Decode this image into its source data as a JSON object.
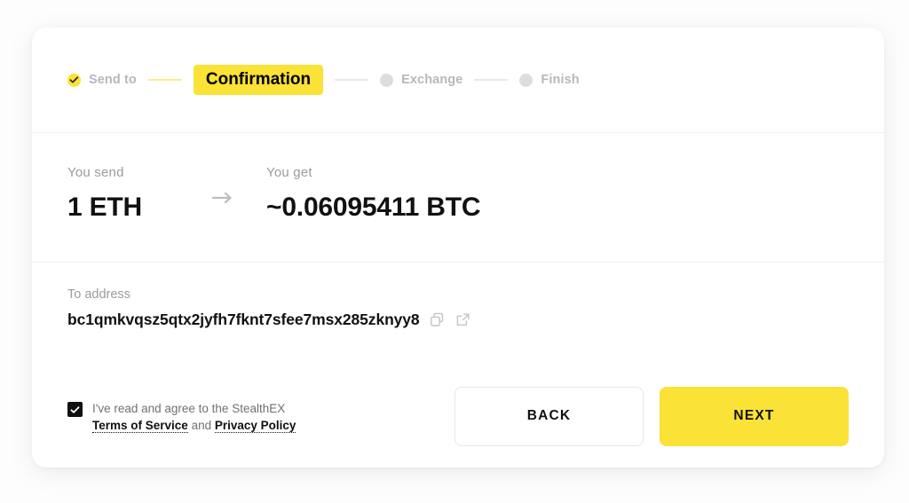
{
  "theme": {
    "accent_yellow": "#FAE237",
    "accent_yellow_light": "#FBEB8C",
    "text_dark": "#111111",
    "text_muted": "#9A9CA1",
    "step_inactive": "#DCDDE0",
    "divider": "#F0F0F2"
  },
  "stepper": {
    "steps": [
      {
        "label": "Send to",
        "state": "done",
        "icon": "check-icon"
      },
      {
        "label": "Confirmation",
        "state": "current"
      },
      {
        "label": "Exchange",
        "state": "pending",
        "icon": "dot-icon"
      },
      {
        "label": "Finish",
        "state": "pending",
        "icon": "dot-icon"
      }
    ]
  },
  "exchange": {
    "send_caption": "You send",
    "send_value": "1 ETH",
    "arrow_icon": "arrow-right-icon",
    "get_caption": "You get",
    "get_value": "~0.06095411 BTC"
  },
  "address": {
    "caption": "To address",
    "value": "bc1qmkvqsz5qtx2jyfh7fknt7sfee7msx285zknyy8",
    "copy_icon": "copy-icon",
    "external_icon": "external-link-icon"
  },
  "terms": {
    "checked": true,
    "line1": "I've read and agree to the StealthEX",
    "terms_link": "Terms of Service",
    "conjunction": " and ",
    "privacy_link": "Privacy Policy"
  },
  "actions": {
    "back_label": "BACK",
    "next_label": "NEXT"
  }
}
